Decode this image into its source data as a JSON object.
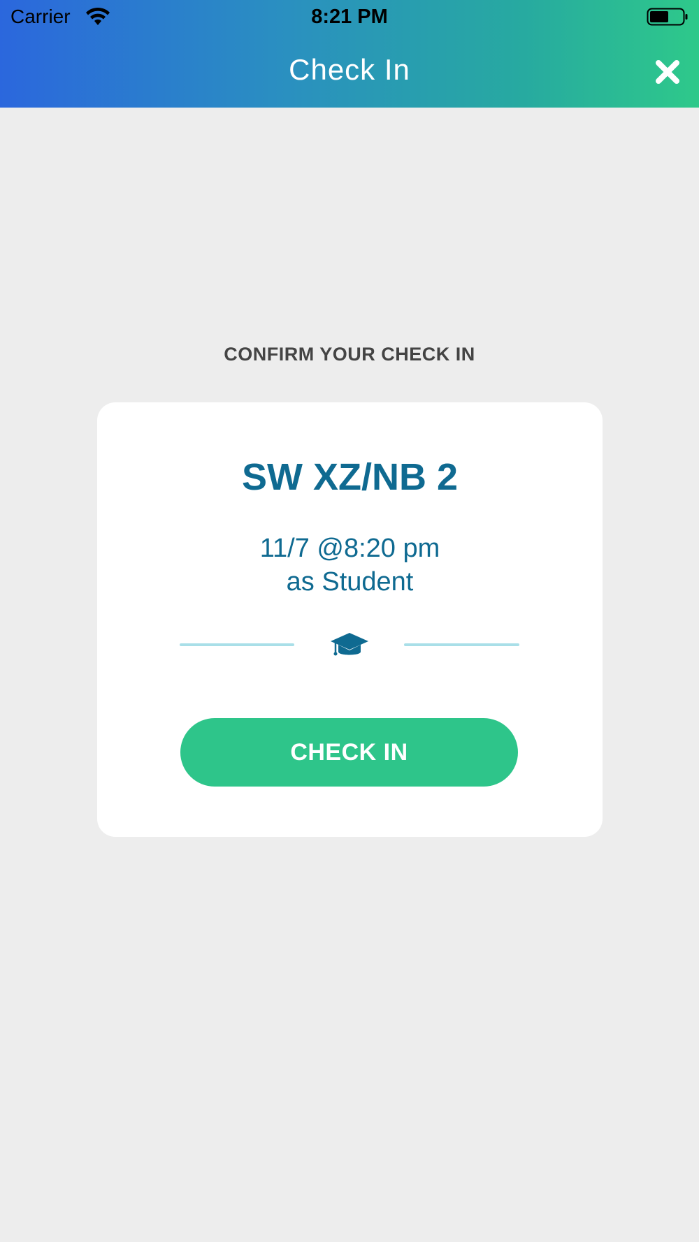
{
  "status_bar": {
    "carrier": "Carrier",
    "time": "8:21 PM",
    "wifi_icon": "wifi-icon",
    "battery_icon": "battery-icon"
  },
  "header": {
    "title": "Check In",
    "close_icon": "close-icon"
  },
  "confirm": {
    "label": "CONFIRM YOUR CHECK IN"
  },
  "card": {
    "title": "SW XZ/NB 2",
    "datetime": "11/7 @8:20 pm",
    "role": "as Student",
    "role_icon": "graduation-cap-icon",
    "button_label": "CHECK IN"
  },
  "colors": {
    "gradient_start": "#2b67dd",
    "gradient_end": "#2ec98a",
    "accent_text": "#0f6a91",
    "button": "#2ec58a",
    "background": "#ededed"
  }
}
